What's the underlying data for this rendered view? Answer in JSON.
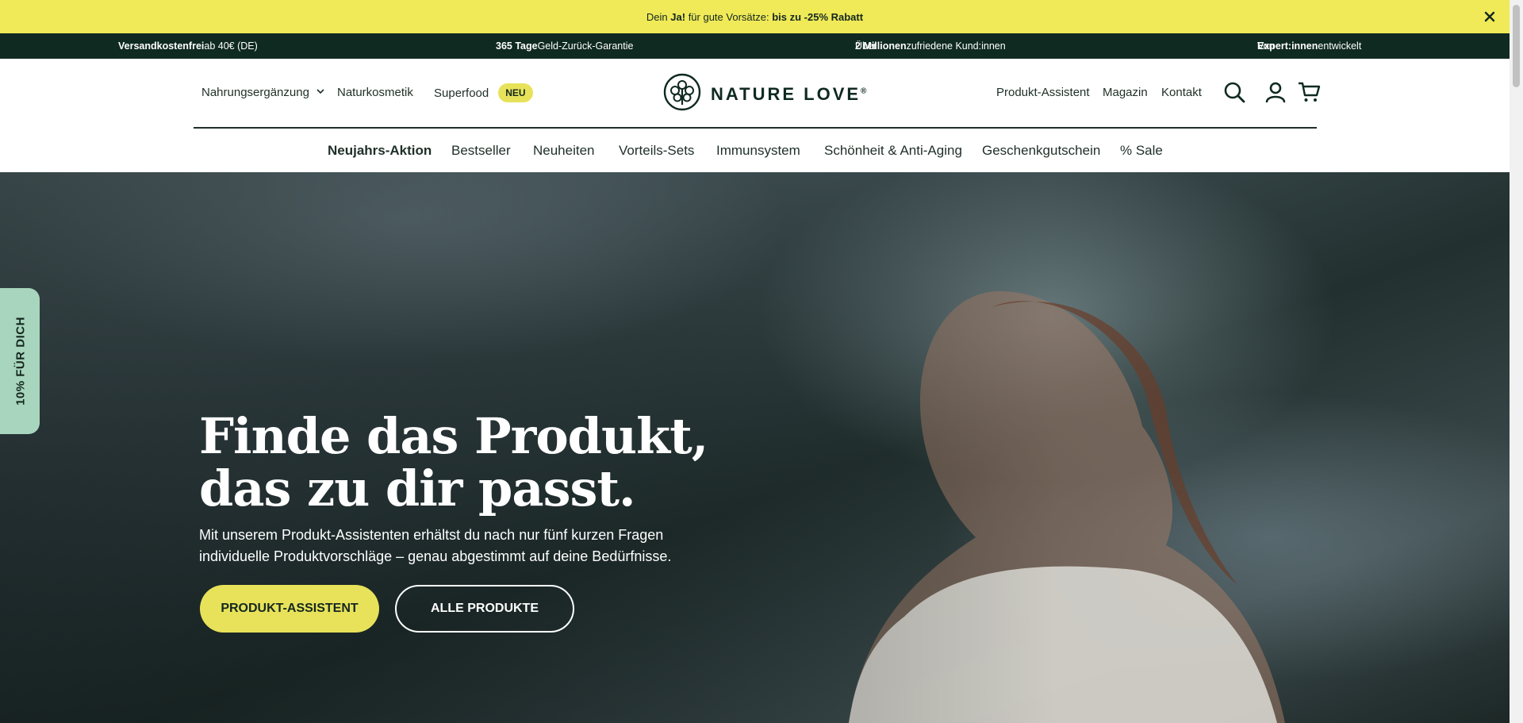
{
  "announcement": {
    "prefix": "Dein ",
    "ja": "Ja!",
    "middle": " für gute Vorsätze: ",
    "highlight": "bis zu -25% Rabatt",
    "close_icon": "close-icon"
  },
  "usp": [
    {
      "bold": "Versandkostenfrei",
      "rest": " ab 40€ (DE)"
    },
    {
      "bold": "365 Tage",
      "rest": " Geld-Zurück-Garantie"
    },
    {
      "pre": "Über ",
      "bold": "2 Millionen",
      "rest": " zufriedene Kund:innen"
    },
    {
      "pre": "Von ",
      "bold": "Expert:innen",
      "rest": " entwickelt"
    }
  ],
  "header": {
    "nav_left": [
      {
        "label": "Nahrungsergänzung",
        "has_dropdown": true
      },
      {
        "label": "Naturkosmetik"
      },
      {
        "label": "Superfood",
        "badge": "NEU"
      }
    ],
    "logo_text": "NATURE LOVE",
    "logo_mark": "®",
    "nav_right": [
      "Produkt-Assistent",
      "Magazin",
      "Kontakt"
    ],
    "icons": [
      "search-icon",
      "account-icon",
      "cart-icon"
    ]
  },
  "categories": [
    {
      "label": "Neujahrs-Aktion",
      "bold": true
    },
    {
      "label": "Bestseller"
    },
    {
      "label": "Neuheiten"
    },
    {
      "label": "Vorteils-Sets"
    },
    {
      "label": "Immunsystem"
    },
    {
      "label": "Schönheit & Anti-Aging"
    },
    {
      "label": "Geschenkgutschein"
    },
    {
      "label": "% Sale"
    }
  ],
  "hero": {
    "title_line1": "Finde das Produkt,",
    "title_line2": "das zu dir passt.",
    "sub_line1": "Mit unserem Produkt-Assistenten erhältst du nach nur fünf kurzen Fragen",
    "sub_line2": "individuelle Produktvorschläge – genau abgestimmt auf deine Bedürfnisse.",
    "btn_primary": "PRODUKT-ASSISTENT",
    "btn_secondary": "ALLE PRODUKTE"
  },
  "side_tab": "10% FÜR DICH",
  "colors": {
    "accent_yellow": "#f0ea58",
    "dark_green": "#0f2a20",
    "mint": "#a8d5bd"
  }
}
